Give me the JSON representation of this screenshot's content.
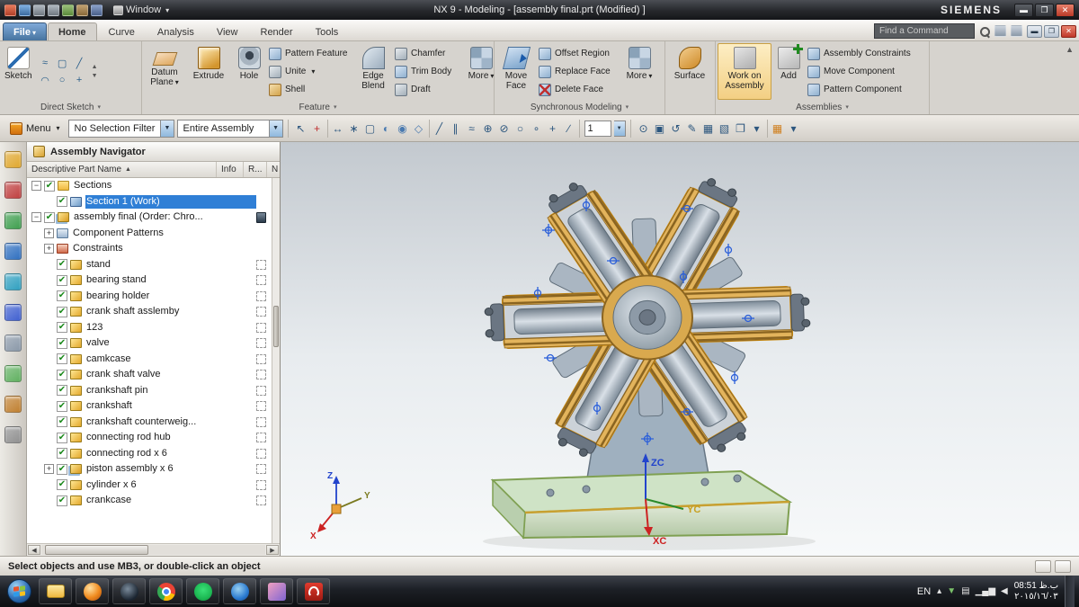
{
  "titlebar": {
    "window_menu": "Window",
    "title": "NX 9 - Modeling - [assembly final.prt (Modified) ]",
    "brand": "SIEMENS"
  },
  "tabs": {
    "file": "File",
    "home": "Home",
    "curve": "Curve",
    "analysis": "Analysis",
    "view": "View",
    "render": "Render",
    "tools": "Tools"
  },
  "find_command": {
    "placeholder": "Find a Command"
  },
  "ribbon": {
    "direct_sketch": {
      "group": "Direct Sketch",
      "sketch": "Sketch",
      "tools": [
        {
          "name": "profile-icon",
          "glyph": "≈"
        },
        {
          "name": "rectangle-icon",
          "glyph": "▢"
        },
        {
          "name": "line-icon",
          "glyph": "╱"
        },
        {
          "name": "arc-icon",
          "glyph": "◠"
        },
        {
          "name": "circle-icon",
          "glyph": "○"
        },
        {
          "name": "point-icon",
          "glyph": "+"
        }
      ]
    },
    "feature": {
      "group": "Feature",
      "datum_plane": "Datum Plane",
      "extrude": "Extrude",
      "hole": "Hole",
      "pattern_feature": "Pattern Feature",
      "unite": "Unite",
      "shell": "Shell",
      "edge_blend": "Edge Blend",
      "chamfer": "Chamfer",
      "trim_body": "Trim Body",
      "draft": "Draft",
      "more": "More"
    },
    "synchronous": {
      "group": "Synchronous Modeling",
      "move_face": "Move Face",
      "offset_region": "Offset Region",
      "replace_face": "Replace Face",
      "delete_face": "Delete Face",
      "more": "More"
    },
    "surface_group": {
      "surface": "Surface"
    },
    "assemblies": {
      "group": "Assemblies",
      "work_on_assembly": "Work on Assembly",
      "add": "Add",
      "assembly_constraints": "Assembly Constraints",
      "move_component": "Move Component",
      "pattern_component": "Pattern Component"
    }
  },
  "toolbar": {
    "menu": "Menu",
    "selection_filter": "No Selection Filter",
    "selection_scope": "Entire Assembly",
    "value": "1",
    "icons_a": [
      {
        "name": "select-arrow-icon",
        "glyph": "↖"
      },
      {
        "name": "highlight-add-icon",
        "glyph": "+",
        "color": "#c03030"
      },
      {
        "sep": true
      },
      {
        "name": "move-object-icon",
        "glyph": "↔"
      },
      {
        "name": "snap-point-icon",
        "glyph": "∗"
      },
      {
        "name": "marquee-icon",
        "glyph": "▢"
      },
      {
        "name": "shaded-display-icon",
        "glyph": "◐",
        "color": "#4a7ab0"
      },
      {
        "name": "sphere-display-icon",
        "glyph": "◉",
        "color": "#4a7ab0"
      },
      {
        "name": "component-group-icon",
        "glyph": "◇",
        "color": "#4a7ab0"
      },
      {
        "sep": true
      },
      {
        "name": "line-tool-icon",
        "glyph": "╱"
      },
      {
        "name": "parallel-tool-icon",
        "glyph": "∥"
      },
      {
        "name": "curve-tool-icon",
        "glyph": "≈"
      },
      {
        "name": "datum-axis-icon",
        "glyph": "⊕"
      },
      {
        "name": "datum-plane-icon",
        "glyph": "⊘"
      },
      {
        "name": "circle-tool-icon",
        "glyph": "○"
      },
      {
        "name": "point-tool-icon",
        "glyph": "∘"
      },
      {
        "name": "plus-tool-icon",
        "glyph": "+"
      },
      {
        "name": "angle-tool-icon",
        "glyph": "∕"
      },
      {
        "sep": true
      }
    ],
    "icons_b": [
      {
        "name": "zoom-icon",
        "glyph": "⊙"
      },
      {
        "name": "snapshot-icon",
        "glyph": "▣"
      },
      {
        "name": "rotate-view-icon",
        "glyph": "↺"
      },
      {
        "name": "annotate-icon",
        "glyph": "✎"
      },
      {
        "name": "grid-display-icon",
        "glyph": "▦"
      },
      {
        "name": "style-icon",
        "glyph": "▧"
      },
      {
        "name": "window-tile-icon",
        "glyph": "❐"
      },
      {
        "name": "more-options-icon",
        "glyph": "▾"
      },
      {
        "sep": true
      },
      {
        "name": "layer-panel-icon",
        "glyph": "▦",
        "color": "#d08020"
      },
      {
        "name": "panel-arrow-icon",
        "glyph": "▾"
      }
    ]
  },
  "side_panel": {
    "icons": [
      {
        "name": "assembly-navigator-icon",
        "color": "#e0a830"
      },
      {
        "name": "constraint-navigator-icon",
        "color": "#c04040"
      },
      {
        "name": "part-navigator-icon",
        "color": "#3f9f4f"
      },
      {
        "name": "reuse-library-icon",
        "color": "#3070c0"
      },
      {
        "name": "hd3d-tools-icon",
        "color": "#30a0c0"
      },
      {
        "name": "web-browser-icon",
        "color": "#4060d0"
      },
      {
        "name": "history-palette-icon",
        "color": "#8a98a8"
      },
      {
        "name": "process-studio-icon",
        "color": "#60b060"
      },
      {
        "name": "manufacturing-wizard-icon",
        "color": "#c08030"
      },
      {
        "name": "roles-icon",
        "color": "#909090"
      }
    ]
  },
  "navigator": {
    "title": "Assembly Navigator",
    "columns": [
      "Descriptive Part Name",
      "Info",
      "R...",
      "N"
    ],
    "items": [
      {
        "label": "Sections",
        "level": 0,
        "expander": "minus",
        "checked": true,
        "icon": "folder"
      },
      {
        "label": "Section 1 (Work)",
        "level": 1,
        "checked": true,
        "icon": "section",
        "selected": true
      },
      {
        "label": "assembly final (Order: Chro...",
        "level": 0,
        "expander": "minus",
        "checked": true,
        "icon": "assembly",
        "info": true
      },
      {
        "label": "Component Patterns",
        "level": 1,
        "expander": "plus",
        "icon": "patterns"
      },
      {
        "label": "Constraints",
        "level": 1,
        "expander": "plus",
        "icon": "constraints"
      },
      {
        "label": "stand",
        "level": 1,
        "checked": true,
        "icon": "part",
        "dash": true
      },
      {
        "label": "bearing stand",
        "level": 1,
        "checked": true,
        "icon": "part",
        "dash": true
      },
      {
        "label": "bearing holder",
        "level": 1,
        "checked": true,
        "icon": "part",
        "dash": true
      },
      {
        "label": "crank shaft asslemby",
        "level": 1,
        "checked": true,
        "icon": "part",
        "dash": true
      },
      {
        "label": "123",
        "level": 1,
        "checked": true,
        "icon": "part",
        "dash": true
      },
      {
        "label": "valve",
        "level": 1,
        "checked": true,
        "icon": "part",
        "dash": true
      },
      {
        "label": "camkcase",
        "level": 1,
        "checked": true,
        "icon": "part",
        "dash": true
      },
      {
        "label": "crank shaft valve",
        "level": 1,
        "checked": true,
        "icon": "part",
        "dash": true
      },
      {
        "label": "crankshaft pin",
        "level": 1,
        "checked": true,
        "icon": "part",
        "dash": true
      },
      {
        "label": "crankshaft",
        "level": 1,
        "checked": true,
        "icon": "part",
        "dash": true
      },
      {
        "label": "crankshaft counterweig...",
        "level": 1,
        "checked": true,
        "icon": "part",
        "dash": true
      },
      {
        "label": "connecting rod hub",
        "level": 1,
        "checked": true,
        "icon": "part",
        "dash": true
      },
      {
        "label": "connecting rod x 6",
        "level": 1,
        "checked": true,
        "icon": "part",
        "dash": true
      },
      {
        "label": "piston assembly x 6",
        "level": 1,
        "expander": "plus",
        "checked": true,
        "icon": "assembly",
        "dash": true
      },
      {
        "label": "cylinder x 6",
        "level": 1,
        "checked": true,
        "icon": "part",
        "dash": true
      },
      {
        "label": "crankcase",
        "level": 1,
        "checked": true,
        "icon": "part",
        "dash": true
      }
    ]
  },
  "viewport": {
    "axes": {
      "z": "Z",
      "y": "Y",
      "x": "X",
      "zc": "ZC",
      "yc": "YC",
      "xc": "XC"
    }
  },
  "status_bar": {
    "message": "Select objects and use MB3, or double-click an object"
  },
  "taskbar": {
    "language": "EN",
    "time": "08:51 ب.ظ",
    "date": "٢٠١٥/١٦/٠٣",
    "apps": [
      {
        "name": "windows-explorer-icon"
      },
      {
        "name": "firefox-icon"
      },
      {
        "name": "dark-browser-icon"
      },
      {
        "name": "chrome-icon"
      },
      {
        "name": "spotify-icon"
      },
      {
        "name": "ie-icon"
      },
      {
        "name": "gallery-icon"
      },
      {
        "name": "adobe-reader-icon"
      }
    ],
    "tray": [
      {
        "name": "hidden-icons-icon",
        "glyph": "▴"
      },
      {
        "name": "safely-remove-icon",
        "glyph": "▼",
        "color": "#7ac06a"
      },
      {
        "name": "display-icon",
        "glyph": "▤"
      },
      {
        "name": "network-icon",
        "glyph": "▁▄▆"
      },
      {
        "name": "volume-icon",
        "glyph": "◀"
      }
    ]
  }
}
